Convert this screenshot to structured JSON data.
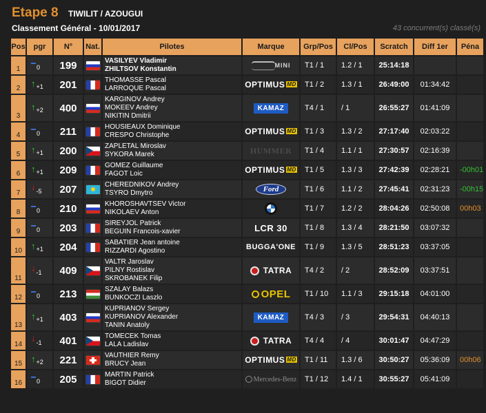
{
  "header": {
    "stage": "Etape 8",
    "route": "TIWILIT / AZOUGUI",
    "subtitle": "Classement Général - 10/01/2017",
    "competitors": "43 concurrent(s) classé(s)"
  },
  "columns": {
    "pos": "Pos",
    "pgr": "pgr",
    "num": "N°",
    "nat": "Nat.",
    "pilots": "Pilotes",
    "marque": "Marque",
    "grp": "Grp/Pos",
    "cl": "Cl/Pos",
    "scratch": "Scratch",
    "diff": "Diff 1er",
    "pena": "Péna"
  },
  "colors": {
    "accent": "#e7a25d",
    "title": "#e38f2f",
    "up_arrow": "#33cc33",
    "down_arrow": "#cc2222",
    "pena_green": "#33c233",
    "pena_orange": "#e38f2f"
  },
  "rows": [
    {
      "pos": "1",
      "trend": "same",
      "pgr": "0",
      "num": "199",
      "nat": "flag-russia",
      "pilots": [
        "VASILYEV Vladimir",
        "ZHILTSOV Konstantin"
      ],
      "marque": "MINI",
      "grp": "T1 / 1",
      "cl": "1.2 / 1",
      "scratch": "25:14:18",
      "diff": "",
      "pena": "",
      "pena_color": ""
    },
    {
      "pos": "2",
      "trend": "up",
      "pgr": "+1",
      "num": "201",
      "nat": "flag-france",
      "pilots": [
        "THOMASSE Pascal",
        "LARROQUE Pascal"
      ],
      "marque": "OPTIMUS",
      "grp": "T1 / 2",
      "cl": "1.3 / 1",
      "scratch": "26:49:00",
      "diff": "01:34:42",
      "pena": "",
      "pena_color": ""
    },
    {
      "pos": "3",
      "trend": "up",
      "pgr": "+2",
      "num": "400",
      "nat": "flag-russia",
      "pilots": [
        "KARGINOV Andrey",
        "MOKEEV Andrey",
        "NIKITIN Dmitrii"
      ],
      "marque": "KAMAZ",
      "grp": "T4 / 1",
      "cl": "/ 1",
      "scratch": "26:55:27",
      "diff": "01:41:09",
      "pena": "",
      "pena_color": ""
    },
    {
      "pos": "4",
      "trend": "same",
      "pgr": "0",
      "num": "211",
      "nat": "flag-france",
      "pilots": [
        "HOUSIEAUX Dominique",
        "CRESPO Christophe"
      ],
      "marque": "OPTIMUS",
      "grp": "T1 / 3",
      "cl": "1.3 / 2",
      "scratch": "27:17:40",
      "diff": "02:03:22",
      "pena": "",
      "pena_color": ""
    },
    {
      "pos": "5",
      "trend": "up",
      "pgr": "+1",
      "num": "200",
      "nat": "flag-czech",
      "pilots": [
        "ZAPLETAL Miroslav",
        "SYKORA Marek"
      ],
      "marque": "HUMMER",
      "grp": "T1 / 4",
      "cl": "1.1 / 1",
      "scratch": "27:30:57",
      "diff": "02:16:39",
      "pena": "",
      "pena_color": ""
    },
    {
      "pos": "6",
      "trend": "up",
      "pgr": "+1",
      "num": "209",
      "nat": "flag-france",
      "pilots": [
        "GOMEZ Guillaume",
        "FAGOT Loic"
      ],
      "marque": "OPTIMUS",
      "grp": "T1 / 5",
      "cl": "1.3 / 3",
      "scratch": "27:42:39",
      "diff": "02:28:21",
      "pena": "-00h01",
      "pena_color": "green"
    },
    {
      "pos": "7",
      "trend": "down",
      "pgr": "-5",
      "num": "207",
      "nat": "flag-kazakhstan",
      "pilots": [
        "CHEREDNIKOV Andrey",
        "TSYRO Dmytro"
      ],
      "marque": "Ford",
      "grp": "T1 / 6",
      "cl": "1.1 / 2",
      "scratch": "27:45:41",
      "diff": "02:31:23",
      "pena": "-00h15",
      "pena_color": "green"
    },
    {
      "pos": "8",
      "trend": "same",
      "pgr": "0",
      "num": "210",
      "nat": "flag-russia",
      "pilots": [
        "KHOROSHAVTSEV Victor",
        "NIKOLAEV Anton"
      ],
      "marque": "BMW",
      "grp": "T1 / 7",
      "cl": "1.2 / 2",
      "scratch": "28:04:26",
      "diff": "02:50:08",
      "pena": "00h03",
      "pena_color": "orange"
    },
    {
      "pos": "9",
      "trend": "same",
      "pgr": "0",
      "num": "203",
      "nat": "flag-france",
      "pilots": [
        "SIREYJOL Patrick",
        "BEGUIN Francois-xavier"
      ],
      "marque": "LCR 30",
      "grp": "T1 / 8",
      "cl": "1.3 / 4",
      "scratch": "28:21:50",
      "diff": "03:07:32",
      "pena": "",
      "pena_color": ""
    },
    {
      "pos": "10",
      "trend": "up",
      "pgr": "+1",
      "num": "204",
      "nat": "flag-france",
      "pilots": [
        "SABATIER Jean antoine",
        "RIZZARDI Agostino"
      ],
      "marque": "BUGGA'ONE",
      "grp": "T1 / 9",
      "cl": "1.3 / 5",
      "scratch": "28:51:23",
      "diff": "03:37:05",
      "pena": "",
      "pena_color": ""
    },
    {
      "pos": "11",
      "trend": "down",
      "pgr": "-1",
      "num": "409",
      "nat": "flag-czech",
      "pilots": [
        "VALTR Jaroslav",
        "PILNY Rostislav",
        "SKROBANEK Filip"
      ],
      "marque": "TATRA",
      "grp": "T4 / 2",
      "cl": "/ 2",
      "scratch": "28:52:09",
      "diff": "03:37:51",
      "pena": "",
      "pena_color": ""
    },
    {
      "pos": "12",
      "trend": "same",
      "pgr": "0",
      "num": "213",
      "nat": "flag-hungary",
      "pilots": [
        "SZALAY Balazs",
        "BUNKOCZI Laszlo"
      ],
      "marque": "OPEL",
      "grp": "T1 / 10",
      "cl": "1.1 / 3",
      "scratch": "29:15:18",
      "diff": "04:01:00",
      "pena": "",
      "pena_color": ""
    },
    {
      "pos": "13",
      "trend": "up",
      "pgr": "+1",
      "num": "403",
      "nat": "flag-russia",
      "pilots": [
        "KUPRIANOV Sergey",
        "KUPRIANOV Alexander",
        "TANIN Anatoly"
      ],
      "marque": "KAMAZ",
      "grp": "T4 / 3",
      "cl": "/ 3",
      "scratch": "29:54:31",
      "diff": "04:40:13",
      "pena": "",
      "pena_color": ""
    },
    {
      "pos": "14",
      "trend": "down",
      "pgr": "-1",
      "num": "401",
      "nat": "flag-czech",
      "pilots": [
        "TOMECEK Tomas",
        "LALA Ladislav"
      ],
      "marque": "TATRA",
      "grp": "T4 / 4",
      "cl": "/ 4",
      "scratch": "30:01:47",
      "diff": "04:47:29",
      "pena": "",
      "pena_color": ""
    },
    {
      "pos": "15",
      "trend": "up",
      "pgr": "+2",
      "num": "221",
      "nat": "flag-switzerland",
      "pilots": [
        "VAUTHIER Remy",
        "BRUCY Jean"
      ],
      "marque": "OPTIMUS",
      "grp": "T1 / 11",
      "cl": "1.3 / 6",
      "scratch": "30:50:27",
      "diff": "05:36:09",
      "pena": "00h06",
      "pena_color": "orange"
    },
    {
      "pos": "16",
      "trend": "same",
      "pgr": "0",
      "num": "205",
      "nat": "flag-france",
      "pilots": [
        "MARTIN Patrick",
        "BIGOT Didier"
      ],
      "marque": "Mercedes-Benz",
      "grp": "T1 / 12",
      "cl": "1.4 / 1",
      "scratch": "30:55:27",
      "diff": "05:41:09",
      "pena": "",
      "pena_color": ""
    }
  ]
}
